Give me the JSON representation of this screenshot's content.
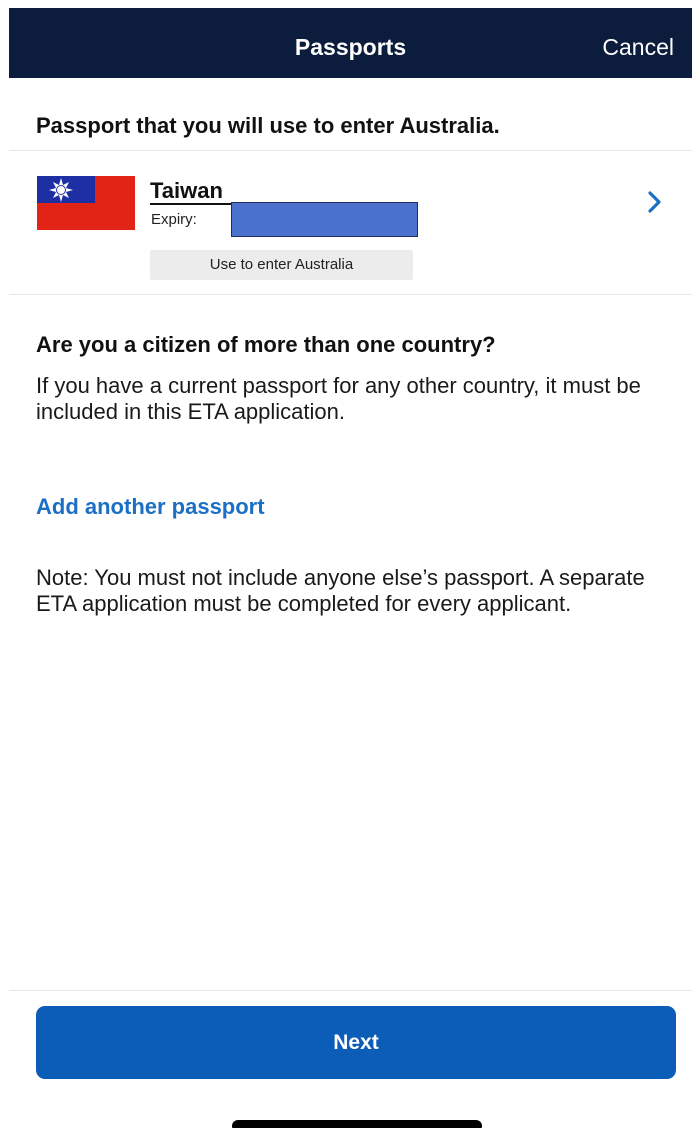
{
  "navbar": {
    "title": "Passports",
    "cancel_label": "Cancel"
  },
  "passports_section": {
    "heading": "Passport that you will use to enter Australia.",
    "items": [
      {
        "country": "Taiwan",
        "expiry_label": "Expiry:",
        "badge": "Use to enter Australia",
        "flag_icon": "taiwan-flag-icon"
      }
    ]
  },
  "citizenship": {
    "heading": "Are you a citizen of more than one country?",
    "body": "If you have a current passport for any other country, it must be included in this ETA application.",
    "add_passport_link": "Add another passport"
  },
  "note": "Note: You must not include anyone else’s passport. A separate ETA application must be completed for every applicant.",
  "footer": {
    "next_label": "Next"
  },
  "colors": {
    "navbar_bg": "#0c1c3c",
    "link": "#1d6fc5",
    "primary_button": "#0b5db8",
    "redaction": "#4a72cc"
  }
}
